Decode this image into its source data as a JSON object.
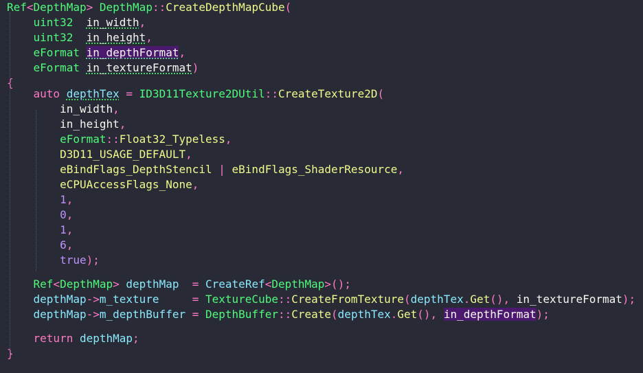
{
  "editor": {
    "colors": {
      "background": "#282a36",
      "keyword": "#ff79c6",
      "type": "#50fa7b",
      "function": "#f1fa8c",
      "constant": "#bd93f9",
      "variable": "#8be9fd",
      "param": "#f8f8f2",
      "highlight": "#4b1a6f"
    },
    "lines": [
      [
        {
          "t": "Ref",
          "c": "#50fa7b"
        },
        {
          "t": "<",
          "c": "#ff79c6"
        },
        {
          "t": "DepthMap",
          "c": "#50fa7b"
        },
        {
          "t": ">",
          "c": "#ff79c6"
        },
        {
          "t": " DepthMap",
          "c": "#50fa7b"
        },
        {
          "t": "::",
          "c": "#ff79c6"
        },
        {
          "t": "CreateDepthMapCube",
          "c": "#f1fa8c"
        },
        {
          "t": "(",
          "c": "#ff79c6"
        }
      ],
      [
        {
          "t": "    uint32  ",
          "c": "#50fa7b"
        },
        {
          "t": "in_width",
          "c": "#f8f8f2",
          "u": true
        },
        {
          "t": ",",
          "c": "#ff79c6"
        }
      ],
      [
        {
          "t": "    uint32  ",
          "c": "#50fa7b"
        },
        {
          "t": "in_height",
          "c": "#f8f8f2",
          "u": true
        },
        {
          "t": ",",
          "c": "#ff79c6"
        }
      ],
      [
        {
          "t": "    eFormat ",
          "c": "#50fa7b"
        },
        {
          "t": "in_depthFormat",
          "c": "#f8f8f2",
          "u": true,
          "h": true
        },
        {
          "t": ",",
          "c": "#ff79c6"
        }
      ],
      [
        {
          "t": "    eFormat ",
          "c": "#50fa7b"
        },
        {
          "t": "in_textureFormat",
          "c": "#f8f8f2",
          "u": true
        },
        {
          "t": ")",
          "c": "#ff79c6"
        }
      ],
      [
        {
          "t": "{",
          "c": "#ff79c6"
        }
      ],
      [
        {
          "t": "    auto ",
          "c": "#ff79c6"
        },
        {
          "t": "depthTex",
          "c": "#8be9fd",
          "u": true
        },
        {
          "t": " = ",
          "c": "#ff79c6"
        },
        {
          "t": "ID3D11Texture2DUtil",
          "c": "#50fa7b"
        },
        {
          "t": "::",
          "c": "#ff79c6"
        },
        {
          "t": "CreateTexture2D",
          "c": "#f1fa8c"
        },
        {
          "t": "(",
          "c": "#ff79c6"
        }
      ],
      [
        {
          "t": "        in_width",
          "c": "#f8f8f2"
        },
        {
          "t": ",",
          "c": "#ff79c6"
        }
      ],
      [
        {
          "t": "        in_height",
          "c": "#f8f8f2"
        },
        {
          "t": ",",
          "c": "#ff79c6"
        }
      ],
      [
        {
          "t": "        eFormat",
          "c": "#50fa7b"
        },
        {
          "t": "::",
          "c": "#ff79c6"
        },
        {
          "t": "Float32_Typeless",
          "c": "#f1fa8c"
        },
        {
          "t": ",",
          "c": "#ff79c6"
        }
      ],
      [
        {
          "t": "        D3D11_USAGE_DEFAULT",
          "c": "#f1fa8c"
        },
        {
          "t": ",",
          "c": "#ff79c6"
        }
      ],
      [
        {
          "t": "        eBindFlags_DepthStencil",
          "c": "#f1fa8c"
        },
        {
          "t": " | ",
          "c": "#ff79c6"
        },
        {
          "t": "eBindFlags_ShaderResource",
          "c": "#f1fa8c"
        },
        {
          "t": ",",
          "c": "#ff79c6"
        }
      ],
      [
        {
          "t": "        eCPUAccessFlags_None",
          "c": "#f1fa8c"
        },
        {
          "t": ",",
          "c": "#ff79c6"
        }
      ],
      [
        {
          "t": "        1",
          "c": "#bd93f9"
        },
        {
          "t": ",",
          "c": "#ff79c6"
        }
      ],
      [
        {
          "t": "        0",
          "c": "#bd93f9"
        },
        {
          "t": ",",
          "c": "#ff79c6"
        }
      ],
      [
        {
          "t": "        1",
          "c": "#bd93f9"
        },
        {
          "t": ",",
          "c": "#ff79c6"
        }
      ],
      [
        {
          "t": "        6",
          "c": "#bd93f9"
        },
        {
          "t": ",",
          "c": "#ff79c6"
        }
      ],
      [
        {
          "t": "        true",
          "c": "#bd93f9"
        },
        {
          "t": ");",
          "c": "#ff79c6"
        }
      ],
      [],
      [
        {
          "t": "    Ref",
          "c": "#50fa7b"
        },
        {
          "t": "<",
          "c": "#ff79c6"
        },
        {
          "t": "DepthMap",
          "c": "#50fa7b"
        },
        {
          "t": ">",
          "c": "#ff79c6"
        },
        {
          "t": " depthMap",
          "c": "#8be9fd"
        },
        {
          "t": "  = ",
          "c": "#ff79c6"
        },
        {
          "t": "CreateRef",
          "c": "#8be9fd"
        },
        {
          "t": "<",
          "c": "#ff79c6"
        },
        {
          "t": "DepthMap",
          "c": "#50fa7b"
        },
        {
          "t": ">();",
          "c": "#ff79c6"
        }
      ],
      [
        {
          "t": "    depthMap",
          "c": "#8be9fd"
        },
        {
          "t": "->",
          "c": "#ff79c6"
        },
        {
          "t": "m_texture",
          "c": "#8be9fd"
        },
        {
          "t": "     = ",
          "c": "#ff79c6"
        },
        {
          "t": "TextureCube",
          "c": "#50fa7b"
        },
        {
          "t": "::",
          "c": "#ff79c6"
        },
        {
          "t": "CreateFromTexture",
          "c": "#f1fa8c"
        },
        {
          "t": "(",
          "c": "#ff79c6"
        },
        {
          "t": "depthTex",
          "c": "#8be9fd"
        },
        {
          "t": ".",
          "c": "#ff79c6"
        },
        {
          "t": "Get",
          "c": "#f1fa8c"
        },
        {
          "t": "(), ",
          "c": "#ff79c6"
        },
        {
          "t": "in_textureFormat",
          "c": "#f8f8f2"
        },
        {
          "t": ");",
          "c": "#ff79c6"
        }
      ],
      [
        {
          "t": "    depthMap",
          "c": "#8be9fd"
        },
        {
          "t": "->",
          "c": "#ff79c6"
        },
        {
          "t": "m_depthBuffer",
          "c": "#8be9fd"
        },
        {
          "t": " = ",
          "c": "#ff79c6"
        },
        {
          "t": "DepthBuffer",
          "c": "#50fa7b"
        },
        {
          "t": "::",
          "c": "#ff79c6"
        },
        {
          "t": "Create",
          "c": "#f1fa8c"
        },
        {
          "t": "(",
          "c": "#ff79c6"
        },
        {
          "t": "depthTex",
          "c": "#8be9fd"
        },
        {
          "t": ".",
          "c": "#ff79c6"
        },
        {
          "t": "Get",
          "c": "#f1fa8c"
        },
        {
          "t": "(), ",
          "c": "#ff79c6"
        },
        {
          "t": "in_depthFormat",
          "c": "#f8f8f2",
          "h": true
        },
        {
          "t": ");",
          "c": "#ff79c6"
        }
      ],
      [],
      [
        {
          "t": "    return ",
          "c": "#ff79c6"
        },
        {
          "t": "depthMap",
          "c": "#8be9fd"
        },
        {
          "t": ";",
          "c": "#ff79c6"
        }
      ],
      [
        {
          "t": "}",
          "c": "#ff79c6"
        }
      ]
    ]
  }
}
